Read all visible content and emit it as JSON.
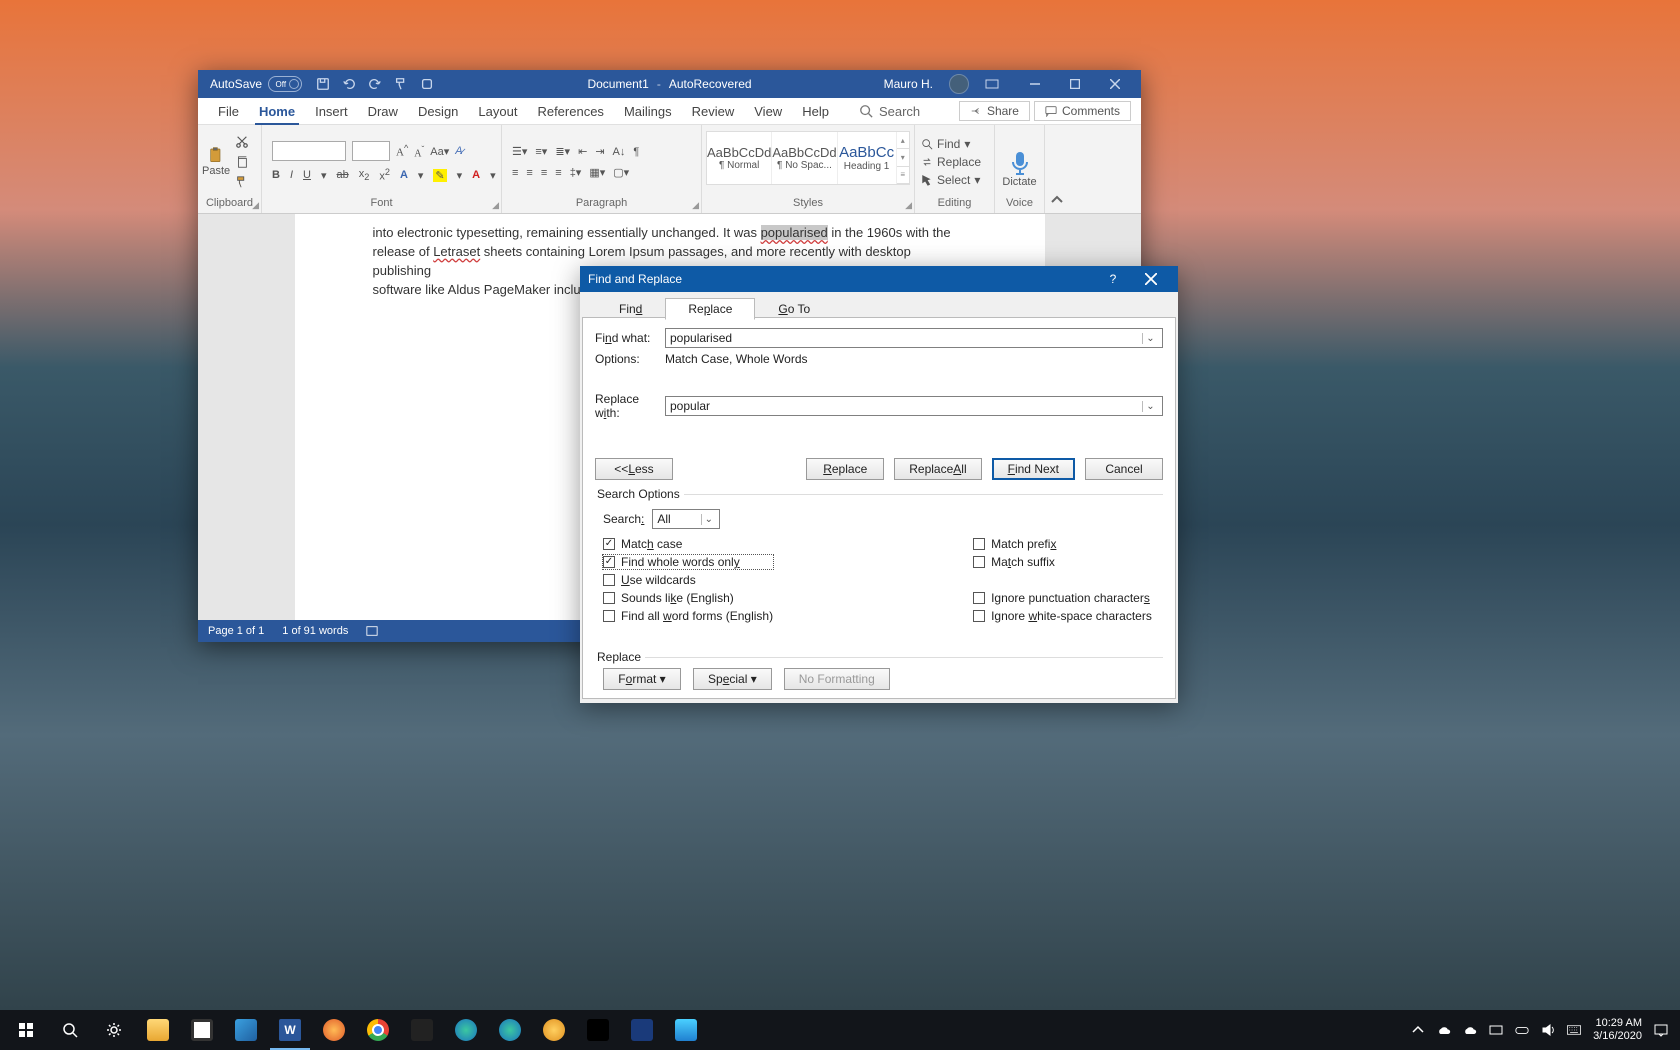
{
  "word": {
    "titlebar": {
      "autosave_label": "AutoSave",
      "autosave_state": "Off",
      "doc_name": "Document1",
      "doc_subtitle": "AutoRecovered",
      "username": "Mauro H."
    },
    "menus": [
      "File",
      "Home",
      "Insert",
      "Draw",
      "Design",
      "Layout",
      "References",
      "Mailings",
      "Review",
      "View",
      "Help"
    ],
    "search_placeholder": "Search",
    "share_label": "Share",
    "comments_label": "Comments",
    "ribbon": {
      "clipboard": {
        "paste": "Paste",
        "label": "Clipboard"
      },
      "font": {
        "label": "Font"
      },
      "paragraph": {
        "label": "Paragraph"
      },
      "styles": {
        "label": "Styles",
        "items": [
          {
            "preview": "AaBbCcDd",
            "name": "¶ Normal"
          },
          {
            "preview": "AaBbCcDd",
            "name": "¶ No Spac..."
          },
          {
            "preview": "AaBbCc",
            "name": "Heading 1"
          }
        ]
      },
      "editing": {
        "find": "Find",
        "replace": "Replace",
        "select": "Select",
        "label": "Editing"
      },
      "voice": {
        "dictate": "Dictate",
        "label": "Voice"
      }
    },
    "document_text": {
      "line1a": "into electronic typesetting, remaining essentially unchanged. It was ",
      "popularised": "popularised",
      "line1b": " in the 1960s with the",
      "line2a": "release of ",
      "letraset": "Letraset",
      "line2b": " sheets containing Lorem Ipsum passages, and more recently with desktop publishing",
      "line3": "software like Aldus PageMaker including versions of Lorem Ipsum."
    },
    "statusbar": {
      "page": "Page 1 of 1",
      "words": "1 of 91 words"
    }
  },
  "find_replace": {
    "title": "Find and Replace",
    "tabs": {
      "find": "Find",
      "replace": "Replace",
      "goto": "Go To"
    },
    "find_what_label": "Find what:",
    "find_what_value": "popularised",
    "options_label": "Options:",
    "options_value": "Match Case, Whole Words",
    "replace_with_label": "Replace with:",
    "replace_with_value": "popular",
    "buttons": {
      "less": "<< Less",
      "replace": "Replace",
      "replace_all": "Replace All",
      "find_next": "Find Next",
      "cancel": "Cancel"
    },
    "search_options_legend": "Search Options",
    "search_label": "Search:",
    "search_dir_value": "All",
    "checkboxes": {
      "match_case": "Match case",
      "whole_words": "Find whole words only",
      "wildcards": "Use wildcards",
      "sounds_like": "Sounds like (English)",
      "word_forms": "Find all word forms (English)",
      "match_prefix": "Match prefix",
      "match_suffix": "Match suffix",
      "ignore_punct": "Ignore punctuation characters",
      "ignore_ws": "Ignore white-space characters"
    },
    "replace_legend": "Replace",
    "format_btn": "Format",
    "special_btn": "Special",
    "no_formatting_btn": "No Formatting"
  },
  "taskbar": {
    "time": "10:29 AM",
    "date": "3/16/2020"
  }
}
